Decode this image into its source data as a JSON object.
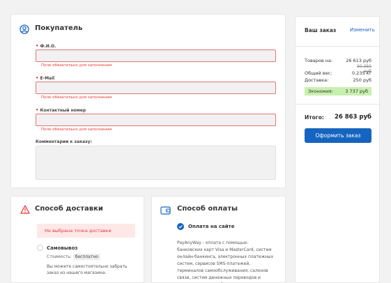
{
  "buyer": {
    "title": "Покупатель",
    "fields": [
      {
        "label": "Ф.И.О.",
        "required": true,
        "value": "",
        "error": "Поле обязательно для заполнения"
      },
      {
        "label": "E-Mail",
        "required": true,
        "value": "",
        "error": "Поле обязательно для заполнения"
      },
      {
        "label": "Контактный номер",
        "required": true,
        "value": "",
        "error": "Поле обязательно для заполнения"
      }
    ],
    "comment_label": "Комментарии к заказу:",
    "comment_value": ""
  },
  "order": {
    "title": "Ваш заказ",
    "edit_link": "Изменить",
    "goods_label": "Товаров на:",
    "goods_value": "26 613 руб",
    "goods_old": "30 350 руб",
    "weight_label": "Общий вес:",
    "weight_value": "0.235 кг",
    "delivery_label": "Доставка:",
    "delivery_value": "250 руб",
    "savings_label": "Экономия:",
    "savings_value": "3 737 руб",
    "total_label": "Итого:",
    "total_value": "26 863 руб",
    "submit_label": "Оформить заказ"
  },
  "delivery": {
    "title": "Способ доставки",
    "alert": "Не выбрана точка доставки",
    "option_name": "Самовывоз",
    "cost_label": "Стоимость:",
    "cost_value": "бесплатно",
    "description": "Вы можете самостоятельно забрать заказ из нашего магазина."
  },
  "payment": {
    "title": "Способ оплаты",
    "option_name": "Оплата на сайте",
    "description": "PayAnyWay - оплата с помощью: банковских карт Visa и MasterCard, систем онлайн-банкинга, электронных платежных систем, сервисов SMS-платежей, терминалов самообслуживания, салонов связи, систем денежных переводов и почтовых отделений."
  },
  "colors": {
    "accent": "#1565c0",
    "error": "#e53935",
    "savings_bg": "#c8f0b0"
  }
}
